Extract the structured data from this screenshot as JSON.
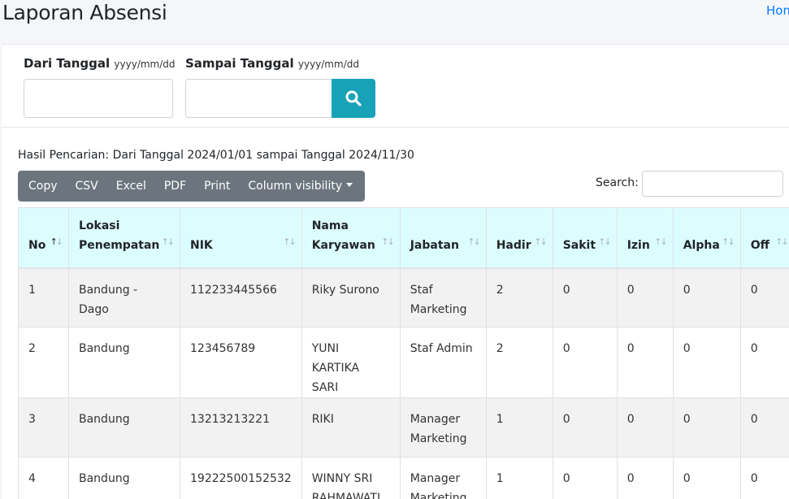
{
  "page": {
    "title": "Laporan Absensi",
    "breadcrumb_home": "Home"
  },
  "filter": {
    "from_label": "Dari Tanggal",
    "from_hint": "yyyy/mm/dd",
    "from_value": "",
    "to_label": "Sampai Tanggal",
    "to_hint": "yyyy/mm/dd",
    "to_value": "",
    "search_button_icon": "search-icon",
    "search_button_color": "#17a2b8"
  },
  "result": {
    "text": "Hasil Pencarian: Dari Tanggal 2024/01/01 sampai Tanggal 2024/11/30"
  },
  "toolbar": {
    "copy": "Copy",
    "csv": "CSV",
    "excel": "Excel",
    "pdf": "PDF",
    "print": "Print",
    "column_visibility": "Column visibility"
  },
  "search": {
    "label": "Search:",
    "value": ""
  },
  "table": {
    "headers": {
      "no": "No",
      "lokasi_line1": "Lokasi",
      "lokasi_line2": "Penempatan",
      "nik": "NIK",
      "nama_line1": "Nama",
      "nama_line2": "Karyawan",
      "jabatan": "Jabatan",
      "hadir": "Hadir",
      "sakit": "Sakit",
      "izin": "Izin",
      "alpha": "Alpha",
      "off": "Off"
    },
    "header_bg": "#dcfdfe",
    "rows": [
      {
        "no": "1",
        "lokasi": "Bandung - Dago",
        "nik": "112233445566",
        "nama_l1": "Riky Surono",
        "nama_l2": "",
        "jabatan_l1": "Staf",
        "jabatan_l2": "Marketing",
        "hadir": "2",
        "sakit": "0",
        "izin": "0",
        "alpha": "0",
        "off": "0"
      },
      {
        "no": "2",
        "lokasi": "Bandung",
        "nik": "123456789",
        "nama_l1": "YUNI KARTIKA",
        "nama_l2": "SARI",
        "jabatan_l1": "Staf Admin",
        "jabatan_l2": "",
        "hadir": "2",
        "sakit": "0",
        "izin": "0",
        "alpha": "0",
        "off": "0"
      },
      {
        "no": "3",
        "lokasi": "Bandung",
        "nik": "13213213221",
        "nama_l1": "RIKI",
        "nama_l2": "",
        "jabatan_l1": "Manager",
        "jabatan_l2": "Marketing",
        "hadir": "1",
        "sakit": "0",
        "izin": "0",
        "alpha": "0",
        "off": "0"
      },
      {
        "no": "4",
        "lokasi": "Bandung",
        "nik": "19222500152532",
        "nama_l1": "WINNY SRI",
        "nama_l2": "RAHMAWATI",
        "jabatan_l1": "Manager",
        "jabatan_l2": "Marketing",
        "hadir": "1",
        "sakit": "0",
        "izin": "0",
        "alpha": "0",
        "off": "0"
      }
    ]
  }
}
